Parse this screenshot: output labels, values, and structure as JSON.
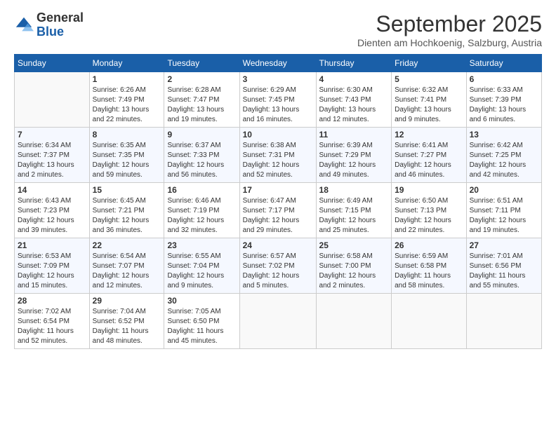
{
  "logo": {
    "general": "General",
    "blue": "Blue"
  },
  "title": "September 2025",
  "subtitle": "Dienten am Hochkoenig, Salzburg, Austria",
  "days_of_week": [
    "Sunday",
    "Monday",
    "Tuesday",
    "Wednesday",
    "Thursday",
    "Friday",
    "Saturday"
  ],
  "weeks": [
    [
      {
        "num": "",
        "info": ""
      },
      {
        "num": "1",
        "info": "Sunrise: 6:26 AM\nSunset: 7:49 PM\nDaylight: 13 hours\nand 22 minutes."
      },
      {
        "num": "2",
        "info": "Sunrise: 6:28 AM\nSunset: 7:47 PM\nDaylight: 13 hours\nand 19 minutes."
      },
      {
        "num": "3",
        "info": "Sunrise: 6:29 AM\nSunset: 7:45 PM\nDaylight: 13 hours\nand 16 minutes."
      },
      {
        "num": "4",
        "info": "Sunrise: 6:30 AM\nSunset: 7:43 PM\nDaylight: 13 hours\nand 12 minutes."
      },
      {
        "num": "5",
        "info": "Sunrise: 6:32 AM\nSunset: 7:41 PM\nDaylight: 13 hours\nand 9 minutes."
      },
      {
        "num": "6",
        "info": "Sunrise: 6:33 AM\nSunset: 7:39 PM\nDaylight: 13 hours\nand 6 minutes."
      }
    ],
    [
      {
        "num": "7",
        "info": "Sunrise: 6:34 AM\nSunset: 7:37 PM\nDaylight: 13 hours\nand 2 minutes."
      },
      {
        "num": "8",
        "info": "Sunrise: 6:35 AM\nSunset: 7:35 PM\nDaylight: 12 hours\nand 59 minutes."
      },
      {
        "num": "9",
        "info": "Sunrise: 6:37 AM\nSunset: 7:33 PM\nDaylight: 12 hours\nand 56 minutes."
      },
      {
        "num": "10",
        "info": "Sunrise: 6:38 AM\nSunset: 7:31 PM\nDaylight: 12 hours\nand 52 minutes."
      },
      {
        "num": "11",
        "info": "Sunrise: 6:39 AM\nSunset: 7:29 PM\nDaylight: 12 hours\nand 49 minutes."
      },
      {
        "num": "12",
        "info": "Sunrise: 6:41 AM\nSunset: 7:27 PM\nDaylight: 12 hours\nand 46 minutes."
      },
      {
        "num": "13",
        "info": "Sunrise: 6:42 AM\nSunset: 7:25 PM\nDaylight: 12 hours\nand 42 minutes."
      }
    ],
    [
      {
        "num": "14",
        "info": "Sunrise: 6:43 AM\nSunset: 7:23 PM\nDaylight: 12 hours\nand 39 minutes."
      },
      {
        "num": "15",
        "info": "Sunrise: 6:45 AM\nSunset: 7:21 PM\nDaylight: 12 hours\nand 36 minutes."
      },
      {
        "num": "16",
        "info": "Sunrise: 6:46 AM\nSunset: 7:19 PM\nDaylight: 12 hours\nand 32 minutes."
      },
      {
        "num": "17",
        "info": "Sunrise: 6:47 AM\nSunset: 7:17 PM\nDaylight: 12 hours\nand 29 minutes."
      },
      {
        "num": "18",
        "info": "Sunrise: 6:49 AM\nSunset: 7:15 PM\nDaylight: 12 hours\nand 25 minutes."
      },
      {
        "num": "19",
        "info": "Sunrise: 6:50 AM\nSunset: 7:13 PM\nDaylight: 12 hours\nand 22 minutes."
      },
      {
        "num": "20",
        "info": "Sunrise: 6:51 AM\nSunset: 7:11 PM\nDaylight: 12 hours\nand 19 minutes."
      }
    ],
    [
      {
        "num": "21",
        "info": "Sunrise: 6:53 AM\nSunset: 7:09 PM\nDaylight: 12 hours\nand 15 minutes."
      },
      {
        "num": "22",
        "info": "Sunrise: 6:54 AM\nSunset: 7:07 PM\nDaylight: 12 hours\nand 12 minutes."
      },
      {
        "num": "23",
        "info": "Sunrise: 6:55 AM\nSunset: 7:04 PM\nDaylight: 12 hours\nand 9 minutes."
      },
      {
        "num": "24",
        "info": "Sunrise: 6:57 AM\nSunset: 7:02 PM\nDaylight: 12 hours\nand 5 minutes."
      },
      {
        "num": "25",
        "info": "Sunrise: 6:58 AM\nSunset: 7:00 PM\nDaylight: 12 hours\nand 2 minutes."
      },
      {
        "num": "26",
        "info": "Sunrise: 6:59 AM\nSunset: 6:58 PM\nDaylight: 11 hours\nand 58 minutes."
      },
      {
        "num": "27",
        "info": "Sunrise: 7:01 AM\nSunset: 6:56 PM\nDaylight: 11 hours\nand 55 minutes."
      }
    ],
    [
      {
        "num": "28",
        "info": "Sunrise: 7:02 AM\nSunset: 6:54 PM\nDaylight: 11 hours\nand 52 minutes."
      },
      {
        "num": "29",
        "info": "Sunrise: 7:04 AM\nSunset: 6:52 PM\nDaylight: 11 hours\nand 48 minutes."
      },
      {
        "num": "30",
        "info": "Sunrise: 7:05 AM\nSunset: 6:50 PM\nDaylight: 11 hours\nand 45 minutes."
      },
      {
        "num": "",
        "info": ""
      },
      {
        "num": "",
        "info": ""
      },
      {
        "num": "",
        "info": ""
      },
      {
        "num": "",
        "info": ""
      }
    ]
  ]
}
